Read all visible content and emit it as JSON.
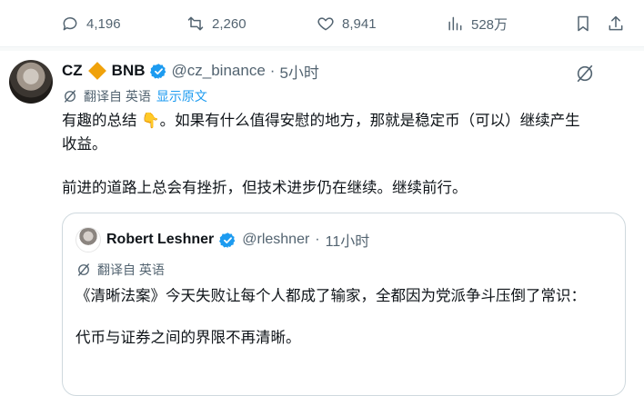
{
  "actions": {
    "reply_count": "4,196",
    "retweet_count": "2,260",
    "like_count": "8,941",
    "views_count": "528万"
  },
  "post": {
    "display_name": "CZ",
    "badge_label": "BNB",
    "handle": "@cz_binance",
    "separator": "·",
    "time": "5小时",
    "translated_from": "翻译自 英语",
    "show_original": "显示原文",
    "paragraph1": "有趣的总结 👇。如果有什么值得安慰的地方，那就是稳定币（可以）继续产生收益。",
    "paragraph2": "前进的道路上总会有挫折，但技术进步仍在继续。继续前行。"
  },
  "quote": {
    "display_name": "Robert Leshner",
    "handle": "@rleshner",
    "separator": "·",
    "time": "11小时",
    "translated_from": "翻译自 英语",
    "paragraph1": "《清晰法案》今天失败让每个人都成了输家，全都因为党派争斗压倒了常识：",
    "paragraph2": "代币与证券之间的界限不再清晰。"
  },
  "colors": {
    "accent": "#1d9bf0",
    "muted": "#536471",
    "bnb": "#f0a20b",
    "border": "#cfd9de"
  }
}
